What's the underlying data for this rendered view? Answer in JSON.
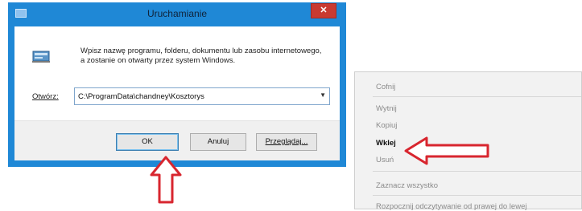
{
  "dialog": {
    "title": "Uruchamianie",
    "close_label": "✕",
    "description": "Wpisz nazwę programu, folderu, dokumentu lub zasobu internetowego, a zostanie on otwarty przez system Windows.",
    "open_label": "Otwórz:",
    "open_value": "C:\\ProgramData\\chandney\\Kosztorys",
    "buttons": {
      "ok": "OK",
      "cancel": "Anuluj",
      "browse": "Przeglądaj..."
    }
  },
  "context_menu": {
    "items": [
      "Cofnij",
      "Wytnij",
      "Kopiuj",
      "Wklej",
      "Usuń",
      "Zaznacz wszystko",
      "Rozpocznij odczytywanie od prawej do lewej"
    ]
  },
  "colors": {
    "title_bar": "#1f88d6",
    "annotation_arrow": "#d8262f"
  },
  "icons": {
    "dialog_app": "run-window-icon",
    "run": "run-program-icon",
    "dropdown": "chevron-down-icon",
    "annotation_up": "red-up-arrow",
    "annotation_left": "red-left-arrow"
  }
}
